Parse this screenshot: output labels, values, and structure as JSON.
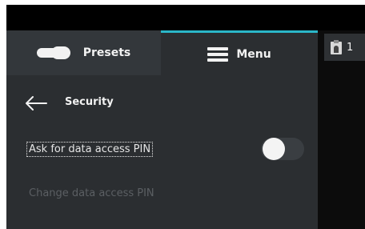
{
  "tabs": {
    "presets_label": "Presets",
    "menu_label": "Menu"
  },
  "header": {
    "title": "Security"
  },
  "settings": {
    "pin_label": "Ask for data access PIN",
    "pin_enabled": false,
    "change_label": "Change data access PIN"
  },
  "badge": {
    "count": "1"
  },
  "colors": {
    "accent": "#2bb6c8",
    "panel": "#2b2e31",
    "text": "#f2f2f2",
    "disabled": "#5b5f63"
  },
  "icons": {
    "presets": "presets-icon",
    "menu": "hamburger-menu-icon",
    "back": "back-arrow-icon",
    "badge": "clipboard-user-icon"
  }
}
